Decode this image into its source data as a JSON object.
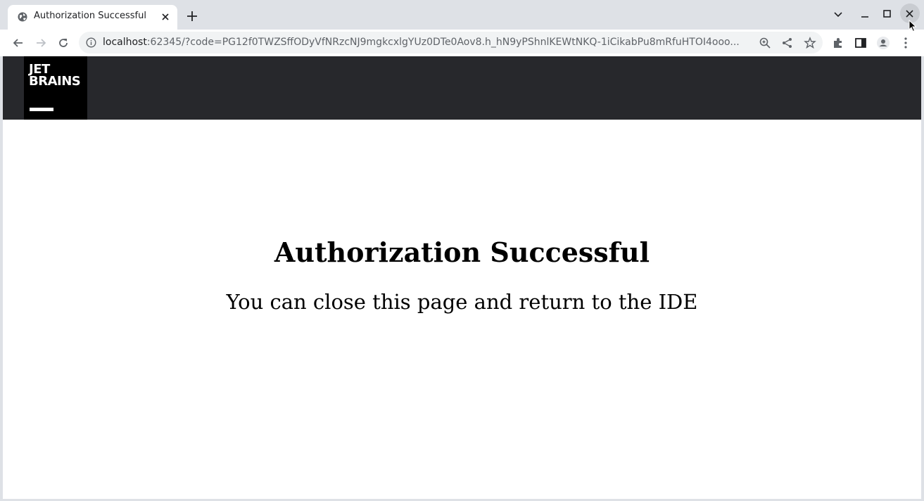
{
  "browser": {
    "tab_title": "Authorization Successful",
    "url_host": "localhost",
    "url_rest": ":62345/?code=PG12f0TWZSffODyVfNRzcNJ9mgkcxlgYUz0DTe0Aov8.h_hN9yPShnlKEWtNKQ-1iCikabPu8mRfuHTOI4ooo..."
  },
  "page": {
    "logo_text": "JET\nBRAINS",
    "heading": "Authorization Successful",
    "message": "You can close this page and return to the IDE"
  },
  "colors": {
    "header_bg": "#27282c",
    "logo_bg": "#000000"
  }
}
